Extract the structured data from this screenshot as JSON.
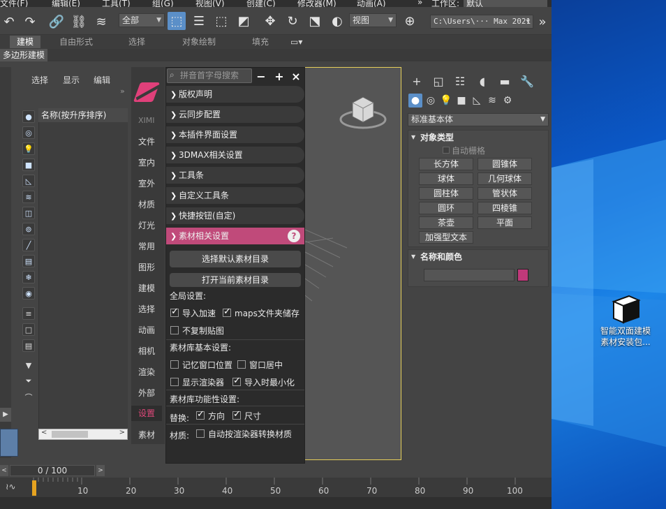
{
  "menubar": {
    "items": [
      "文件(F)",
      "编辑(E)",
      "工具(T)",
      "组(G)",
      "视图(V)",
      "创建(C)",
      "修改器(M)",
      "动画(A)"
    ],
    "workspace_label": "工作区:",
    "workspace_value": "默认"
  },
  "toolbar": {
    "select_filter": "全部",
    "view_drop": "视图",
    "path_value": "C:\\Users\\··· Max 2021"
  },
  "ribbon": {
    "tabs": [
      "建模",
      "自由形式",
      "选择",
      "对象绘制",
      "填充"
    ],
    "sub_label": "多边形建模"
  },
  "scene_explorer": {
    "menu": [
      "选择",
      "显示",
      "编辑"
    ],
    "column_header": "名称(按升序排序)"
  },
  "plugin_side": {
    "brand": "XIMI",
    "items": [
      "文件",
      "室内",
      "室外",
      "材质",
      "灯光",
      "常用",
      "图形",
      "建模",
      "选择",
      "动画",
      "相机",
      "渲染",
      "外部",
      "设置",
      "素材"
    ],
    "active_index": 13
  },
  "plugin_panel": {
    "search_placeholder": "拼音首字母搜索",
    "sections": [
      "版权声明",
      "云同步配置",
      "本插件界面设置",
      "3DMAX相关设置",
      "工具条",
      "自定义工具条",
      "快捷按钮(自定)"
    ],
    "active_section": "素材相关设置",
    "buttons": [
      "选择默认素材目录",
      "打开当前素材目录"
    ],
    "global_label": "全局设置:",
    "import_speed": "导入加速",
    "maps_cache": "maps文件夹储存",
    "no_copy_maps": "不复制贴图",
    "basic_label": "素材库基本设置:",
    "remember_pos": "记忆窗口位置",
    "window_center": "窗口居中",
    "show_renderer": "显示渲染器",
    "minimize_import": "导入时最小化",
    "feature_label": "素材库功能性设置:",
    "replace_label": "替换:",
    "direction": "方向",
    "size": "尺寸",
    "material_label": "材质:",
    "auto_convert": "自动按渲染器转换材质",
    "help_icon": "?"
  },
  "command_panel": {
    "category_drop": "标准基本体",
    "object_type_title": "对象类型",
    "auto_grid": "自动栅格",
    "objects": [
      "长方体",
      "圆锥体",
      "球体",
      "几何球体",
      "圆柱体",
      "管状体",
      "圆环",
      "四棱锥",
      "茶壶",
      "平面",
      "加强型文本"
    ],
    "name_color_title": "名称和颜色",
    "swatch_color": "#c0397a"
  },
  "timeline": {
    "frame_display": "0 / 100",
    "ticks": [
      "10",
      "20",
      "30",
      "40",
      "50",
      "60",
      "70",
      "80",
      "90",
      "100"
    ]
  },
  "desktop": {
    "icon_label_line1": "智能双面建模",
    "icon_label_line2": "素材安装包..."
  }
}
